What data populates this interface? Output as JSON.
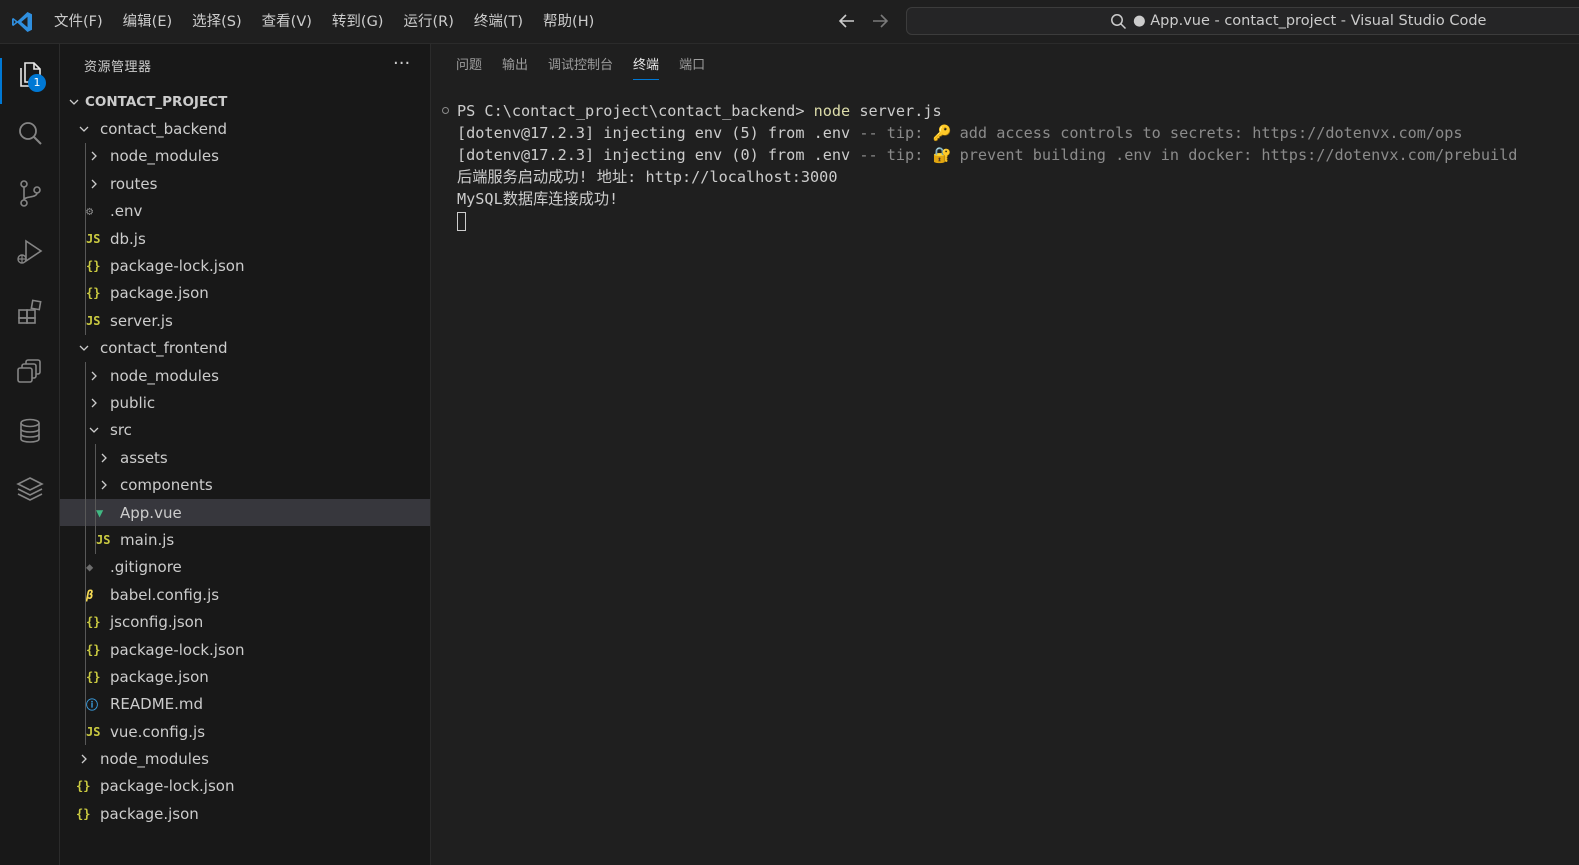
{
  "menubar": [
    "文件(F)",
    "编辑(E)",
    "选择(S)",
    "查看(V)",
    "转到(G)",
    "运行(R)",
    "终端(T)",
    "帮助(H)"
  ],
  "title": "● App.vue - contact_project - Visual Studio Code",
  "activity_badge": "1",
  "explorer": {
    "title": "资源管理器",
    "more": "···",
    "root": "CONTACT_PROJECT",
    "items": [
      {
        "label": "contact_backend",
        "icon": "chevron-down",
        "depth": 1
      },
      {
        "label": "node_modules",
        "icon": "chevron-right",
        "depth": 2
      },
      {
        "label": "routes",
        "icon": "chevron-right",
        "depth": 2
      },
      {
        "label": ".env",
        "icon": "gear",
        "depth": 2
      },
      {
        "label": "db.js",
        "icon": "js",
        "depth": 2
      },
      {
        "label": "package-lock.json",
        "icon": "json",
        "depth": 2
      },
      {
        "label": "package.json",
        "icon": "json",
        "depth": 2
      },
      {
        "label": "server.js",
        "icon": "js",
        "depth": 2
      },
      {
        "label": "contact_frontend",
        "icon": "chevron-down",
        "depth": 1
      },
      {
        "label": "node_modules",
        "icon": "chevron-right",
        "depth": 2
      },
      {
        "label": "public",
        "icon": "chevron-right",
        "depth": 2
      },
      {
        "label": "src",
        "icon": "chevron-down",
        "depth": 2
      },
      {
        "label": "assets",
        "icon": "chevron-right",
        "depth": 3
      },
      {
        "label": "components",
        "icon": "chevron-right",
        "depth": 3
      },
      {
        "label": "App.vue",
        "icon": "vue",
        "depth": 3,
        "selected": true
      },
      {
        "label": "main.js",
        "icon": "js",
        "depth": 3
      },
      {
        "label": ".gitignore",
        "icon": "git",
        "depth": 2
      },
      {
        "label": "babel.config.js",
        "icon": "babel",
        "depth": 2
      },
      {
        "label": "jsconfig.json",
        "icon": "json",
        "depth": 2
      },
      {
        "label": "package-lock.json",
        "icon": "json",
        "depth": 2
      },
      {
        "label": "package.json",
        "icon": "json",
        "depth": 2
      },
      {
        "label": "README.md",
        "icon": "info",
        "depth": 2
      },
      {
        "label": "vue.config.js",
        "icon": "js",
        "depth": 2
      },
      {
        "label": "node_modules",
        "icon": "chevron-right",
        "depth": 1
      },
      {
        "label": "package-lock.json",
        "icon": "json",
        "depth": 1
      },
      {
        "label": "package.json",
        "icon": "json",
        "depth": 1
      }
    ]
  },
  "panel": {
    "tabs": [
      "问题",
      "输出",
      "调试控制台",
      "终端",
      "端口"
    ],
    "active_tab": "终端"
  },
  "terminal": {
    "prompt": "PS C:\\contact_project\\contact_backend> ",
    "command_node": "node",
    "command_rest": " server.js",
    "line2_main": "[dotenv@17.2.3] injecting env (5) from .env",
    "line2_tip": " -- tip: ",
    "line2_emoji": "🔑",
    "line2_text": " add access controls to secrets: https://dotenvx.com/ops",
    "line3_main": "[dotenv@17.2.3] injecting env (0) from .env",
    "line3_tip": " -- tip: ",
    "line3_emoji": "🔐",
    "line3_text": " prevent building .env in docker: https://dotenvx.com/prebuild",
    "line4": "后端服务启动成功! 地址: http://localhost:3000",
    "line5": "MySQL数据库连接成功!"
  },
  "colors": {
    "accent": "#0078d4",
    "json_icon": "#cbcb41",
    "vue_icon": "#41b883",
    "command_highlight": "#dcdcaa"
  }
}
